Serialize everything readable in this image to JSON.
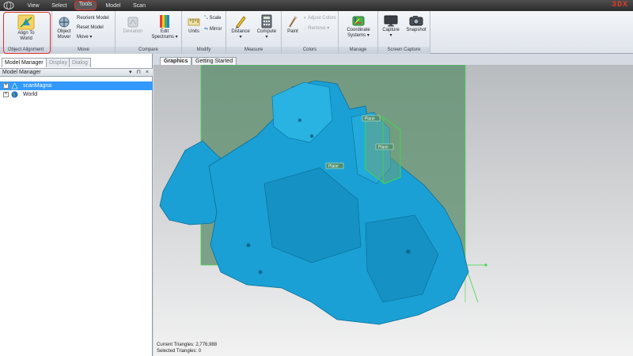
{
  "menu": {
    "items": [
      "View",
      "Select",
      "Tools",
      "Model",
      "Scan"
    ],
    "active": "Tools"
  },
  "brand": "3DX",
  "ribbon": {
    "object_alignment": {
      "label": "Object Alignment",
      "align_to_world": [
        "Align To",
        "World"
      ]
    },
    "move": {
      "label": "Move",
      "object_mover": [
        "Object",
        "Mover"
      ],
      "reorient_model": "Reorient Model",
      "reset_model": "Reset Model",
      "move_dropdown": "Move"
    },
    "compare": {
      "label": "Compare",
      "deviation": "Deviation",
      "edit_spectrums": [
        "Edit",
        "Spectrums"
      ]
    },
    "modify": {
      "label": "Modify",
      "units": "Units",
      "scale": "Scale",
      "mirror": "Mirror"
    },
    "measure": {
      "label": "Measure",
      "distance": "Distance",
      "compute": "Compute"
    },
    "colors": {
      "label": "Colors",
      "paint": "Paint",
      "adjust_colors": "Adjust Colors",
      "remove": "Remove"
    },
    "manage": {
      "label": "Manage",
      "coordinate_systems": [
        "Coordinate",
        "Systems"
      ]
    },
    "screen_capture": {
      "label": "Screen Capture",
      "capture": "Capture",
      "snapshot": "Snapshot"
    }
  },
  "left_panel": {
    "tabs": [
      "Model Manager",
      "Display",
      "Dialog"
    ],
    "active_tab": "Model Manager",
    "header": "Model Manager",
    "header_controls": "▾ ⊓ ×",
    "tree": [
      {
        "label": "scanMagna",
        "selected": true,
        "icon": "mesh-icon"
      },
      {
        "label": "World",
        "selected": false,
        "icon": "globe-icon"
      }
    ]
  },
  "viewport": {
    "tabs": [
      "Graphics",
      "Getting Started"
    ],
    "active_tab": "Graphics",
    "plane_labels": [
      "Plane",
      "Plane",
      "Plane"
    ],
    "status": {
      "current_triangles": "Current Triangles: 2,776,988",
      "selected_triangles": "Selected Triangles: 0"
    },
    "colors": {
      "model": "#1aa0d4",
      "plane": "#5f8f70",
      "plane_edge": "#3fd64f"
    }
  }
}
